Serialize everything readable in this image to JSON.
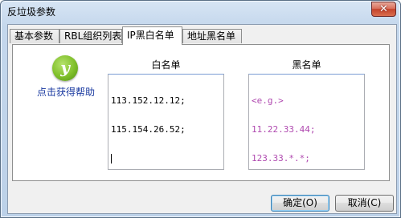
{
  "window": {
    "title": "反垃圾参数",
    "close_glyph": "✕"
  },
  "tabs": [
    {
      "label": "基本参数",
      "active": false
    },
    {
      "label": "RBL组织列表",
      "active": false
    },
    {
      "label": "IP黑白名单",
      "active": true
    },
    {
      "label": "地址黑名单",
      "active": false
    }
  ],
  "help": {
    "icon": "help-logo-icon",
    "logo_glyph": "y",
    "label": "点击获得帮助"
  },
  "whitelist": {
    "title": "白名单",
    "lines": [
      "113.152.12.12;",
      "115.154.26.52;"
    ]
  },
  "blacklist": {
    "title": "黑名单",
    "lines": [
      "<e.g.>",
      "11.22.33.44;",
      "123.33.*.*;"
    ]
  },
  "buttons": {
    "ok": "确定(O)",
    "cancel": "取消(C)"
  }
}
